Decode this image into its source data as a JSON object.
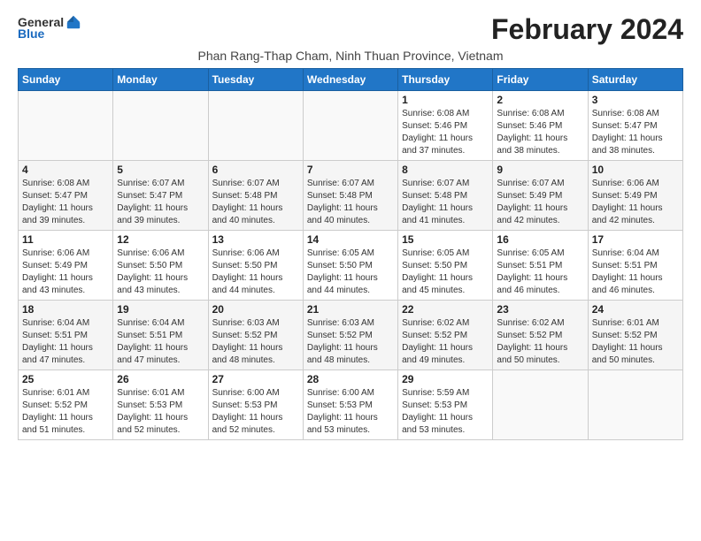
{
  "logo": {
    "text_general": "General",
    "text_blue": "Blue"
  },
  "title": "February 2024",
  "subtitle": "Phan Rang-Thap Cham, Ninh Thuan Province, Vietnam",
  "days_of_week": [
    "Sunday",
    "Monday",
    "Tuesday",
    "Wednesday",
    "Thursday",
    "Friday",
    "Saturday"
  ],
  "weeks": [
    [
      {
        "day": "",
        "info": ""
      },
      {
        "day": "",
        "info": ""
      },
      {
        "day": "",
        "info": ""
      },
      {
        "day": "",
        "info": ""
      },
      {
        "day": "1",
        "info": "Sunrise: 6:08 AM\nSunset: 5:46 PM\nDaylight: 11 hours and 37 minutes."
      },
      {
        "day": "2",
        "info": "Sunrise: 6:08 AM\nSunset: 5:46 PM\nDaylight: 11 hours and 38 minutes."
      },
      {
        "day": "3",
        "info": "Sunrise: 6:08 AM\nSunset: 5:47 PM\nDaylight: 11 hours and 38 minutes."
      }
    ],
    [
      {
        "day": "4",
        "info": "Sunrise: 6:08 AM\nSunset: 5:47 PM\nDaylight: 11 hours and 39 minutes."
      },
      {
        "day": "5",
        "info": "Sunrise: 6:07 AM\nSunset: 5:47 PM\nDaylight: 11 hours and 39 minutes."
      },
      {
        "day": "6",
        "info": "Sunrise: 6:07 AM\nSunset: 5:48 PM\nDaylight: 11 hours and 40 minutes."
      },
      {
        "day": "7",
        "info": "Sunrise: 6:07 AM\nSunset: 5:48 PM\nDaylight: 11 hours and 40 minutes."
      },
      {
        "day": "8",
        "info": "Sunrise: 6:07 AM\nSunset: 5:48 PM\nDaylight: 11 hours and 41 minutes."
      },
      {
        "day": "9",
        "info": "Sunrise: 6:07 AM\nSunset: 5:49 PM\nDaylight: 11 hours and 42 minutes."
      },
      {
        "day": "10",
        "info": "Sunrise: 6:06 AM\nSunset: 5:49 PM\nDaylight: 11 hours and 42 minutes."
      }
    ],
    [
      {
        "day": "11",
        "info": "Sunrise: 6:06 AM\nSunset: 5:49 PM\nDaylight: 11 hours and 43 minutes."
      },
      {
        "day": "12",
        "info": "Sunrise: 6:06 AM\nSunset: 5:50 PM\nDaylight: 11 hours and 43 minutes."
      },
      {
        "day": "13",
        "info": "Sunrise: 6:06 AM\nSunset: 5:50 PM\nDaylight: 11 hours and 44 minutes."
      },
      {
        "day": "14",
        "info": "Sunrise: 6:05 AM\nSunset: 5:50 PM\nDaylight: 11 hours and 44 minutes."
      },
      {
        "day": "15",
        "info": "Sunrise: 6:05 AM\nSunset: 5:50 PM\nDaylight: 11 hours and 45 minutes."
      },
      {
        "day": "16",
        "info": "Sunrise: 6:05 AM\nSunset: 5:51 PM\nDaylight: 11 hours and 46 minutes."
      },
      {
        "day": "17",
        "info": "Sunrise: 6:04 AM\nSunset: 5:51 PM\nDaylight: 11 hours and 46 minutes."
      }
    ],
    [
      {
        "day": "18",
        "info": "Sunrise: 6:04 AM\nSunset: 5:51 PM\nDaylight: 11 hours and 47 minutes."
      },
      {
        "day": "19",
        "info": "Sunrise: 6:04 AM\nSunset: 5:51 PM\nDaylight: 11 hours and 47 minutes."
      },
      {
        "day": "20",
        "info": "Sunrise: 6:03 AM\nSunset: 5:52 PM\nDaylight: 11 hours and 48 minutes."
      },
      {
        "day": "21",
        "info": "Sunrise: 6:03 AM\nSunset: 5:52 PM\nDaylight: 11 hours and 48 minutes."
      },
      {
        "day": "22",
        "info": "Sunrise: 6:02 AM\nSunset: 5:52 PM\nDaylight: 11 hours and 49 minutes."
      },
      {
        "day": "23",
        "info": "Sunrise: 6:02 AM\nSunset: 5:52 PM\nDaylight: 11 hours and 50 minutes."
      },
      {
        "day": "24",
        "info": "Sunrise: 6:01 AM\nSunset: 5:52 PM\nDaylight: 11 hours and 50 minutes."
      }
    ],
    [
      {
        "day": "25",
        "info": "Sunrise: 6:01 AM\nSunset: 5:52 PM\nDaylight: 11 hours and 51 minutes."
      },
      {
        "day": "26",
        "info": "Sunrise: 6:01 AM\nSunset: 5:53 PM\nDaylight: 11 hours and 52 minutes."
      },
      {
        "day": "27",
        "info": "Sunrise: 6:00 AM\nSunset: 5:53 PM\nDaylight: 11 hours and 52 minutes."
      },
      {
        "day": "28",
        "info": "Sunrise: 6:00 AM\nSunset: 5:53 PM\nDaylight: 11 hours and 53 minutes."
      },
      {
        "day": "29",
        "info": "Sunrise: 5:59 AM\nSunset: 5:53 PM\nDaylight: 11 hours and 53 minutes."
      },
      {
        "day": "",
        "info": ""
      },
      {
        "day": "",
        "info": ""
      }
    ]
  ]
}
